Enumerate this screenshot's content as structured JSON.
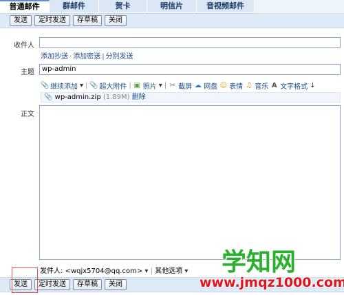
{
  "tabs": [
    "普通邮件",
    "群邮件",
    "贺卡",
    "明信片",
    "音视频邮件"
  ],
  "toolbar": {
    "send": "发送",
    "timed_send": "定时发送",
    "save_draft": "存草稿",
    "close": "关闭"
  },
  "recipient": {
    "label": "收件人",
    "value": "",
    "links": [
      "添加抄送",
      "添加密送",
      "分别发送"
    ]
  },
  "subject": {
    "label": "主题",
    "value": "wp-admin"
  },
  "attach_toolbar": {
    "items": [
      {
        "icon": "paperclip-icon",
        "label": "继续添加"
      },
      {
        "icon": "super-attachment-icon",
        "label": "超大附件"
      },
      {
        "icon": "photo-icon",
        "label": "照片"
      },
      {
        "icon": "screenshot-icon",
        "label": "截屏"
      },
      {
        "icon": "netdisk-icon",
        "label": "网盘"
      },
      {
        "icon": "emoticon-icon",
        "label": "表情"
      },
      {
        "icon": "music-icon",
        "label": "音乐"
      },
      {
        "icon": "text-format-icon",
        "label": "文字格式"
      }
    ]
  },
  "attachment": {
    "filename": "wp-admin.zip",
    "size": "(1.89M)",
    "delete": "删除"
  },
  "body": {
    "label": "正文"
  },
  "footer": {
    "sender_label": "发件人:",
    "sender": "<wqjx5704@qq.com>",
    "other_options": "其他选项"
  },
  "watermark": {
    "title": "学知网",
    "url": "www.jmqz1000.com"
  },
  "colors": {
    "tab_bg": "#dbe7f5",
    "toolbar_bg": "#dfeaf7",
    "link": "#1a4c8c",
    "highlight": "#d9534f",
    "watermark_title": "#29b12d",
    "watermark_url": "#e0141a"
  }
}
